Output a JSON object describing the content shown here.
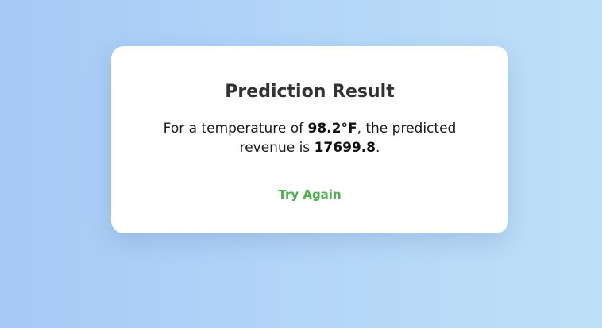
{
  "result": {
    "title": "Prediction Result",
    "text_prefix": "For a temperature of ",
    "temperature": "98.2°F",
    "text_middle": ", the predicted revenue is ",
    "revenue": "17699.8",
    "text_suffix": "."
  },
  "actions": {
    "try_again_label": "Try Again"
  },
  "colors": {
    "link": "#4caf50",
    "title": "#333333",
    "card": "#ffffff"
  }
}
